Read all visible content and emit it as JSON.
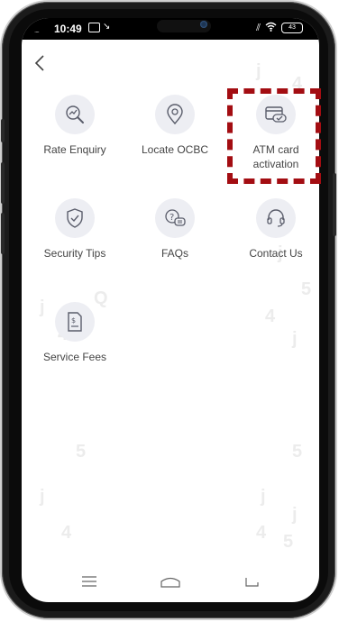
{
  "status_bar": {
    "time": "10:49",
    "battery": "43"
  },
  "back_button_icon": "chevron-left-icon",
  "tiles": [
    {
      "label": "Rate Enquiry",
      "icon": "rate-chart-magnifier-icon"
    },
    {
      "label": "Locate OCBC",
      "icon": "location-pin-icon"
    },
    {
      "label": "ATM card activation",
      "icon": "atm-card-check-icon"
    },
    {
      "label": "Security Tips",
      "icon": "shield-check-icon"
    },
    {
      "label": "FAQs",
      "icon": "faq-chat-icon"
    },
    {
      "label": "Contact Us",
      "icon": "headset-icon"
    },
    {
      "label": "Service Fees",
      "icon": "fee-document-icon"
    }
  ],
  "highlight_color": "#a30d12",
  "nav": {
    "items": [
      "menu-icon",
      "home-icon",
      "back-icon"
    ]
  }
}
